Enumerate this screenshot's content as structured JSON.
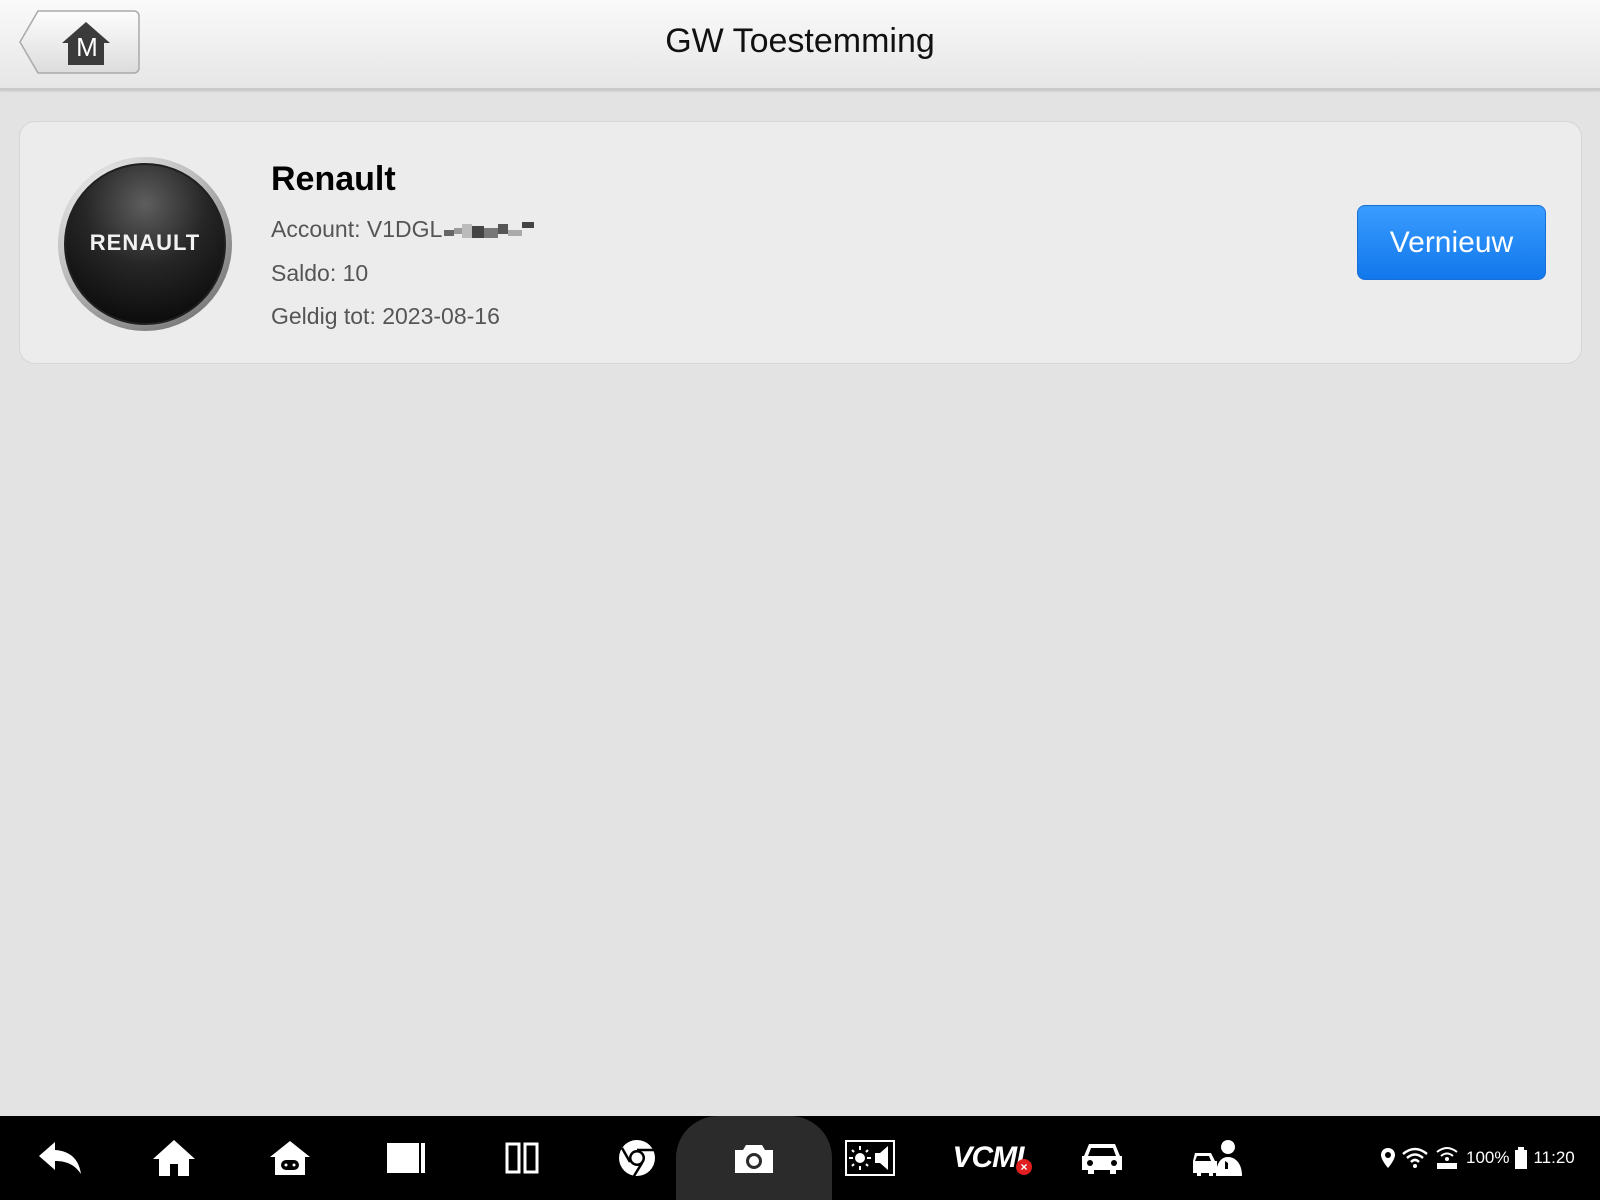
{
  "header": {
    "back_icon_letter": "M",
    "title": "GW Toestemming"
  },
  "card": {
    "logo_text": "RENAULT",
    "brand": "Renault",
    "account": "Account: V1DGL",
    "saldo": "Saldo: 10",
    "valid_until": "Geldig tot: 2023-08-16",
    "renew_label": "Vernieuw"
  },
  "navbar": {
    "icons": [
      "back-icon",
      "home-icon",
      "android-home-icon",
      "window-icon",
      "split-screen-icon",
      "chrome-icon",
      "camera-icon",
      "display-volume-icon",
      "vcmi-icon",
      "car-icon",
      "car-technician-icon"
    ],
    "vcmi_label": "VCMI",
    "vcmi_error": "×"
  },
  "status": {
    "battery": "100%",
    "time": "11:20"
  },
  "colors": {
    "accent": "#1178ec",
    "background": "#e3e3e3",
    "card": "#ececec",
    "navbar": "#000000"
  }
}
